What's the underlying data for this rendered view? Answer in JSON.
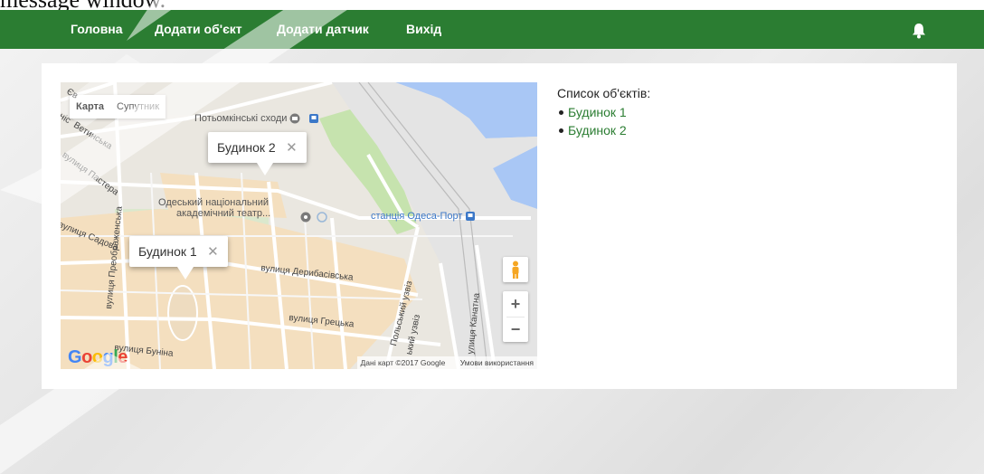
{
  "document_caption": "message window.",
  "navbar": {
    "items": [
      {
        "label": "Головна"
      },
      {
        "label": "Додати об'єкт"
      },
      {
        "label": "Додати датчик"
      },
      {
        "label": "Вихід"
      }
    ],
    "bell_icon": "bell-icon",
    "background": "#2b7d32"
  },
  "map": {
    "type_control": {
      "map": "Карта",
      "satellite": "Супутник"
    },
    "streets": [
      "вулиця Пастера",
      "вулиця Садова",
      "вулиця Преображенська",
      "вулиця Дерибасівська",
      "вулиця Грецька",
      "вулиця Буніна",
      "Польський узвіз",
      "ький узвіз",
      "улиця Канатна",
      "Ветинська",
      "ніс",
      "Єв"
    ],
    "pois": {
      "stairs": "Потьомкінські сходи",
      "theatre_line1": "Одеський національний",
      "theatre_line2": "академічний театр...",
      "station": "станція Одеса-Порт"
    },
    "infowindows": [
      {
        "label": "Будинок 2",
        "close": "✕"
      },
      {
        "label": "Будинок 1",
        "close": "✕"
      }
    ],
    "zoom": {
      "in": "+",
      "out": "−"
    },
    "logo": {
      "g1": "G",
      "o1": "o",
      "o2": "o",
      "g2": "g",
      "l": "l",
      "e": "e"
    },
    "attribution": {
      "data": "Дані карт ©2017 Google",
      "terms": "Умови використання"
    }
  },
  "object_list": {
    "title": "Список об'єктів:",
    "items": [
      "Будинок 1",
      "Будинок 2"
    ]
  }
}
